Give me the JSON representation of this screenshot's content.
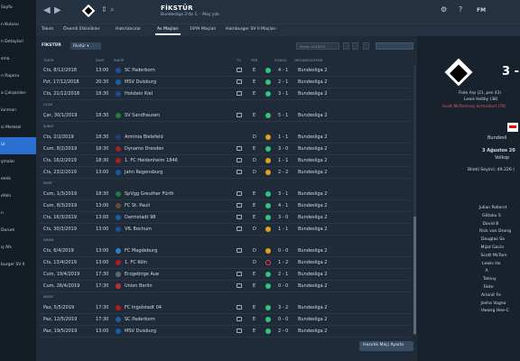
{
  "sidebar": {
    "items": [
      "Sayfa",
      "",
      "n Kutusu",
      "",
      "n Detaylari",
      "",
      "sma",
      "",
      "n Raporu",
      "a Çalışanları",
      "lonman",
      "",
      "si Merkezi",
      "ür",
      "",
      "şmalar",
      "",
      "emik",
      "efeln",
      "",
      "",
      "n",
      "",
      "Durum",
      "ış Afs",
      "",
      "burger SV II"
    ]
  },
  "header": {
    "title": "FİKSTÜR",
    "subtitle": "Bundesliga 2'de 1. - Maç yok",
    "right_label": "FM",
    "back": "◀",
    "forward": "▶"
  },
  "tabs": [
    "Takım",
    "Önemli Etkinlikler",
    "Hatırlatıcılar",
    "As Maçları",
    "19YA Maçları",
    "Hamburger SV II Maçları"
  ],
  "subbar": {
    "label": "FİKSTÜR",
    "dropdown": "Fikstür",
    "search_placeholder": "Sezon 2018/19"
  },
  "columns": [
    "TARİH",
    "SAAT",
    "RAKİP",
    "TV",
    "YER",
    "SONUÇ",
    "ORGANİZASYON"
  ],
  "months": [
    "OCAK",
    "ŞUBAT",
    "MART",
    "NİSAN",
    "MAYIS"
  ],
  "matches": [
    {
      "date": "Cts, 8/12/2018",
      "time": "13:00",
      "opponent": "SC Paderborn",
      "venue": "E",
      "result": "4 - 1",
      "competition": "Bundesliga 2",
      "tv": true
    },
    {
      "date": "Pzt, 17/12/2018",
      "time": "20:30",
      "opponent": "MSV Duisburg",
      "venue": "E",
      "result": "2 - 1",
      "competition": "Bundesliga 2",
      "tv": true
    },
    {
      "date": "Cts, 21/12/2018",
      "time": "18:30",
      "opponent": "Holstein Kiel",
      "venue": "E",
      "result": "3 - 1",
      "competition": "Bundesliga 2",
      "tv": true
    },
    {
      "date": "Çar, 30/1/2019",
      "time": "18:30",
      "opponent": "SV Sandhausen",
      "venue": "E",
      "result": "5 - 1",
      "competition": "Bundesliga 2",
      "tv": true
    },
    {
      "date": "Cts, 2/2/2019",
      "time": "18:30",
      "opponent": "Arminia Bielefeld",
      "venue": "D",
      "result": "1 - 1",
      "competition": "Bundesliga 2",
      "tv": false
    },
    {
      "date": "Cum, 8/2/2019",
      "time": "18:30",
      "opponent": "Dynamo Dresden",
      "venue": "E",
      "result": "3 - 0",
      "competition": "Bundesliga 2",
      "tv": true
    },
    {
      "date": "Cts, 16/2/2019",
      "time": "18:30",
      "opponent": "1. FC Heidenheim 1846",
      "venue": "D",
      "result": "1 - 1",
      "competition": "Bundesliga 2",
      "tv": true
    },
    {
      "date": "Cts, 23/2/2019",
      "time": "13:00",
      "opponent": "Jahn Regensburg",
      "venue": "D",
      "result": "2 - 2",
      "competition": "Bundesliga 2",
      "tv": true
    },
    {
      "date": "Cum, 1/3/2019",
      "time": "18:30",
      "opponent": "SpVgg Greuther Fürth",
      "venue": "E",
      "result": "3 - 1",
      "competition": "Bundesliga 2",
      "tv": true
    },
    {
      "date": "Cum, 8/3/2019",
      "time": "13:00",
      "opponent": "FC St. Pauli",
      "venue": "E",
      "result": "4 - 1",
      "competition": "Bundesliga 2",
      "tv": true
    },
    {
      "date": "Cts, 16/3/2019",
      "time": "13:00",
      "opponent": "Darmstadt 98",
      "venue": "E",
      "result": "3 - 0",
      "competition": "Bundesliga 2",
      "tv": true
    },
    {
      "date": "Cts, 30/3/2019",
      "time": "13:00",
      "opponent": "VfL Bochum",
      "venue": "D",
      "result": "1 - 1",
      "competition": "Bundesliga 2",
      "tv": true
    },
    {
      "date": "Cts, 6/4/2019",
      "time": "13:00",
      "opponent": "FC Magdeburg",
      "venue": "D",
      "result": "0 - 0",
      "competition": "Bundesliga 2",
      "tv": true
    },
    {
      "date": "Cts, 13/4/2019",
      "time": "13:00",
      "opponent": "1. FC Köln",
      "venue": "D",
      "result": "1 - 2",
      "competition": "Bundesliga 2",
      "tv": false,
      "loss": true
    },
    {
      "date": "Cum, 19/4/2019",
      "time": "17:30",
      "opponent": "Erzgebirge Aue",
      "venue": "E",
      "result": "2 - 1",
      "competition": "Bundesliga 2",
      "tv": true
    },
    {
      "date": "Cum, 26/4/2019",
      "time": "17:30",
      "opponent": "Union Berlin",
      "venue": "E",
      "result": "0 - 0",
      "competition": "Bundesliga 2",
      "tv": true
    },
    {
      "date": "Paz, 5/5/2019",
      "time": "17:30",
      "opponent": "FC Ingolstadt 04",
      "venue": "E",
      "result": "3 - 2",
      "competition": "Bundesliga 2",
      "tv": true
    },
    {
      "date": "Paz, 12/5/2019",
      "time": "17:30",
      "opponent": "SC Paderborn",
      "venue": "E",
      "result": "0 - 0",
      "competition": "Bundesliga 2",
      "tv": true
    },
    {
      "date": "Paz, 19/5/2019",
      "time": "13:00",
      "opponent": "MSV Duisburg",
      "venue": "E",
      "result": "2 - 0",
      "competition": "Bundesliga 2",
      "tv": true
    }
  ],
  "prep_button": "Hazırlık Maçı Ayarla",
  "match_panel": {
    "score": "3 -",
    "scorers": [
      "Fiete Arp (21, pen 43)",
      "Lewis Holtby (38)"
    ],
    "red_card": "Scott McTominay kırmızıkart (78)",
    "competition": "Bundesli",
    "date": "3 Ağustos 20",
    "venue": "Volksp",
    "attendance": "Biletli Seyirci: 49.226 (",
    "lineup": [
      "Julian Pollerst",
      "Gōtoku S",
      "David B",
      "Rick van Drong",
      "Douglas Sa",
      "Mijat Gacin",
      "Scott McTom",
      "Lewis Ho",
      "A",
      "Tatsuy",
      "Fiete",
      "Arianit Fe",
      "Josha Vagno",
      "Hwang Hee-C"
    ]
  }
}
